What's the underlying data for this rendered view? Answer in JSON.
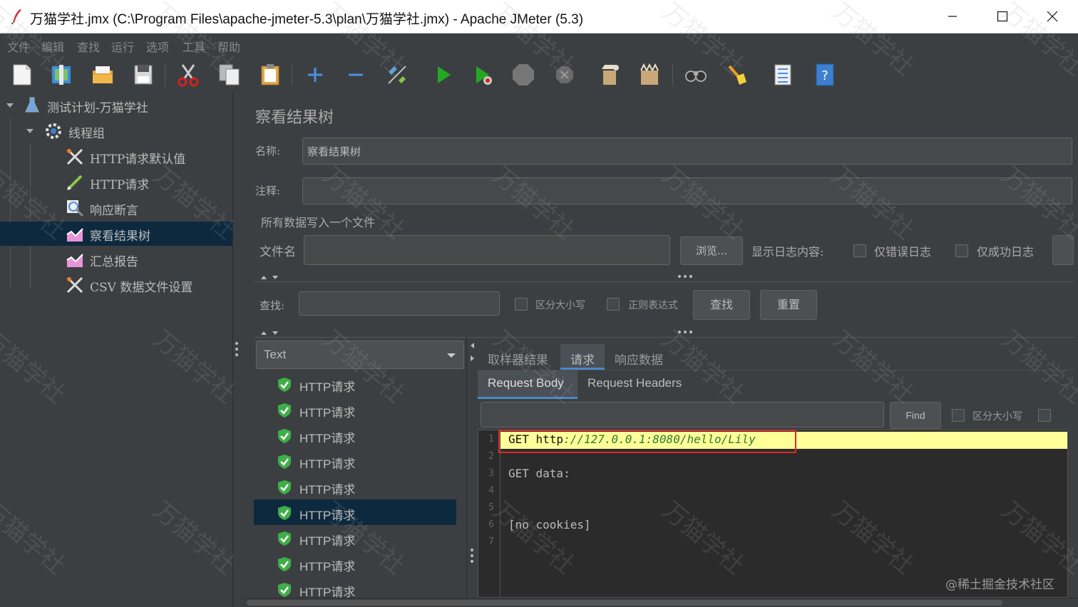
{
  "window": {
    "title": "万猫学社.jmx (C:\\Program Files\\apache-jmeter-5.3\\plan\\万猫学社.jmx) - Apache JMeter (5.3)"
  },
  "menu": [
    "文件",
    "编辑",
    "查找",
    "运行",
    "选项",
    "工具",
    "帮助"
  ],
  "toolbar": {
    "icons": [
      "new-icon",
      "templates-icon",
      "open-icon",
      "save-icon",
      "cut-icon",
      "copy-icon",
      "paste-icon",
      "expand-icon",
      "collapse-icon",
      "toggle-icon",
      "start-icon",
      "start-no-pause-icon",
      "stop-icon",
      "shutdown-icon",
      "clear-icon",
      "clear-all-icon",
      "search-icon",
      "reset-search-icon",
      "function-helper-icon",
      "help-icon"
    ]
  },
  "tree": {
    "items": [
      {
        "label": "测试计划-万猫学社",
        "icon": "test-plan-icon"
      },
      {
        "label": "线程组",
        "icon": "thread-group-icon"
      },
      {
        "label": "HTTP请求默认值",
        "icon": "config-tools-icon"
      },
      {
        "label": "HTTP请求",
        "icon": "sampler-pen-icon"
      },
      {
        "label": "响应断言",
        "icon": "assertion-magnifier-icon"
      },
      {
        "label": "察看结果树",
        "icon": "listener-chart-icon"
      },
      {
        "label": "汇总报告",
        "icon": "listener-chart-icon"
      },
      {
        "label": "CSV 数据文件设置",
        "icon": "config-tools-icon"
      }
    ],
    "selected_index": 5
  },
  "panel": {
    "title": "察看结果树",
    "name_label": "名称:",
    "name_value": "察看结果树",
    "comment_label": "注释:",
    "comment_value": "",
    "file_section": "所有数据写入一个文件",
    "filename_label": "文件名",
    "filename_value": "",
    "browse_button": "浏览...",
    "log_content_label": "显示日志内容:",
    "errors_only": "仅错误日志",
    "success_only": "仅成功日志"
  },
  "search": {
    "label": "查找:",
    "value": "",
    "case_sensitive": "区分大小写",
    "regex": "正则表达式",
    "find_button": "查找",
    "reset_button": "重置"
  },
  "results": {
    "renderer": "Text",
    "items": [
      "HTTP请求",
      "HTTP请求",
      "HTTP请求",
      "HTTP请求",
      "HTTP请求",
      "HTTP请求",
      "HTTP请求",
      "HTTP请求",
      "HTTP请求"
    ],
    "selected_index": 5
  },
  "detail_tabs": {
    "tabs": [
      "取样器结果",
      "请求",
      "响应数据"
    ],
    "active": 1,
    "sub_tabs": [
      "Request Body",
      "Request Headers"
    ],
    "active_sub": 0
  },
  "find_bar": {
    "value": "",
    "find_button": "Find",
    "case_sensitive": "区分大小写"
  },
  "editor": {
    "line_numbers": [
      "1",
      "2",
      "3",
      "4",
      "5",
      "6",
      "7"
    ],
    "line1_method": "GET ",
    "line1_scheme": "http",
    "line1_url": "://127.0.0.1:8080/hello/Lily",
    "line3": "GET data:",
    "line6": "[no cookies]"
  },
  "watermark": {
    "text": "万猫学社",
    "credit": "@稀土掘金技术社区"
  },
  "colors": {
    "background": "#3c3f41",
    "selection": "#0d293e",
    "highlight_line": "#ffff99",
    "annotation_box": "#e0292b",
    "accent_tab": "#4a88c7"
  }
}
